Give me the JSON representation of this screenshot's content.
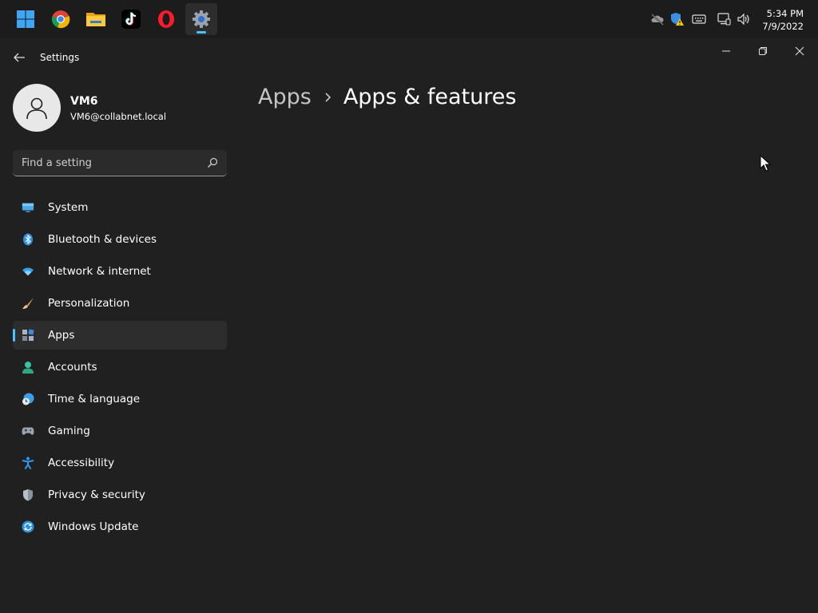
{
  "taskbar": {
    "apps": [
      {
        "name": "start-button",
        "icon": "windows-logo-icon"
      },
      {
        "name": "chrome",
        "icon": "chrome-icon"
      },
      {
        "name": "file-explorer",
        "icon": "folder-icon"
      },
      {
        "name": "tiktok",
        "icon": "tiktok-icon"
      },
      {
        "name": "opera",
        "icon": "opera-icon"
      },
      {
        "name": "settings",
        "icon": "gear-icon",
        "active": true
      }
    ],
    "tray": [
      "cloud-offline-icon",
      "security-warning-icon",
      "keyboard-icon",
      "network-icon",
      "volume-icon"
    ],
    "clock": {
      "time": "5:34 PM",
      "date": "7/9/2022"
    }
  },
  "window": {
    "title": "Settings"
  },
  "profile": {
    "name": "VM6",
    "email": "VM6@collabnet.local"
  },
  "search": {
    "placeholder": "Find a setting"
  },
  "nav": {
    "items": [
      {
        "label": "System",
        "icon": "system-icon"
      },
      {
        "label": "Bluetooth & devices",
        "icon": "bluetooth-icon"
      },
      {
        "label": "Network & internet",
        "icon": "wifi-icon"
      },
      {
        "label": "Personalization",
        "icon": "brush-icon"
      },
      {
        "label": "Apps",
        "icon": "apps-icon",
        "selected": true
      },
      {
        "label": "Accounts",
        "icon": "person-icon"
      },
      {
        "label": "Time & language",
        "icon": "globe-clock-icon"
      },
      {
        "label": "Gaming",
        "icon": "gamepad-icon"
      },
      {
        "label": "Accessibility",
        "icon": "accessibility-icon"
      },
      {
        "label": "Privacy & security",
        "icon": "shield-icon"
      },
      {
        "label": "Windows Update",
        "icon": "update-icon"
      }
    ]
  },
  "breadcrumb": {
    "parent": "Apps",
    "current": "Apps & features"
  },
  "colors": {
    "background": "#202020",
    "accent": "#4cc2ff"
  }
}
